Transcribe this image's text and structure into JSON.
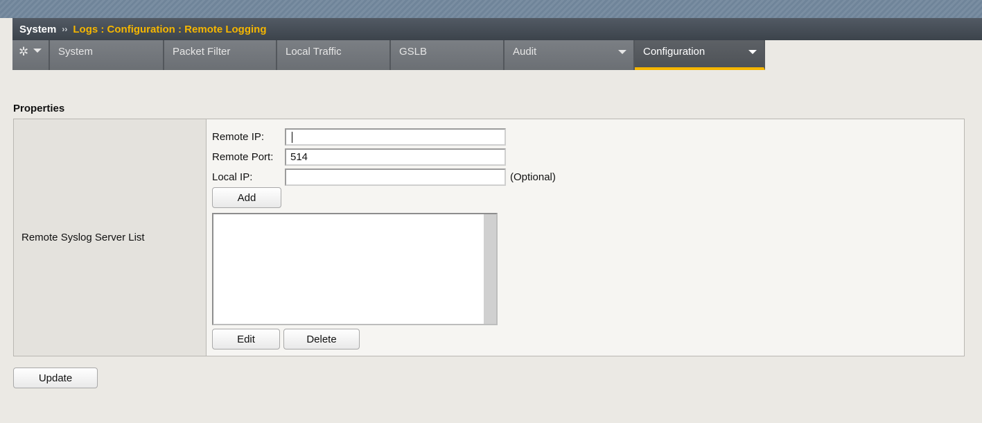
{
  "breadcrumb": {
    "root": "System",
    "separator": "››",
    "path": "Logs : Configuration : Remote Logging"
  },
  "tabs": [
    {
      "label": "System",
      "has_dropdown": false,
      "active": false
    },
    {
      "label": "Packet Filter",
      "has_dropdown": false,
      "active": false
    },
    {
      "label": "Local Traffic",
      "has_dropdown": false,
      "active": false
    },
    {
      "label": "GSLB",
      "has_dropdown": false,
      "active": false
    },
    {
      "label": "Audit",
      "has_dropdown": true,
      "active": false
    },
    {
      "label": "Configuration",
      "has_dropdown": true,
      "active": true
    }
  ],
  "section": {
    "title": "Properties",
    "row_label": "Remote Syslog Server List"
  },
  "form": {
    "remote_ip_label": "Remote IP:",
    "remote_ip_value": "",
    "remote_port_label": "Remote Port:",
    "remote_port_value": "514",
    "local_ip_label": "Local IP:",
    "local_ip_value": "",
    "optional_text": "(Optional)",
    "add_label": "Add",
    "edit_label": "Edit",
    "delete_label": "Delete"
  },
  "server_list": [],
  "update_label": "Update",
  "colors": {
    "accent": "#f5b600",
    "header_bg": "#464d55",
    "tab_bg": "#73777c",
    "page_bg": "#ebe9e4"
  },
  "icons": {
    "settings": "gear-icon"
  }
}
